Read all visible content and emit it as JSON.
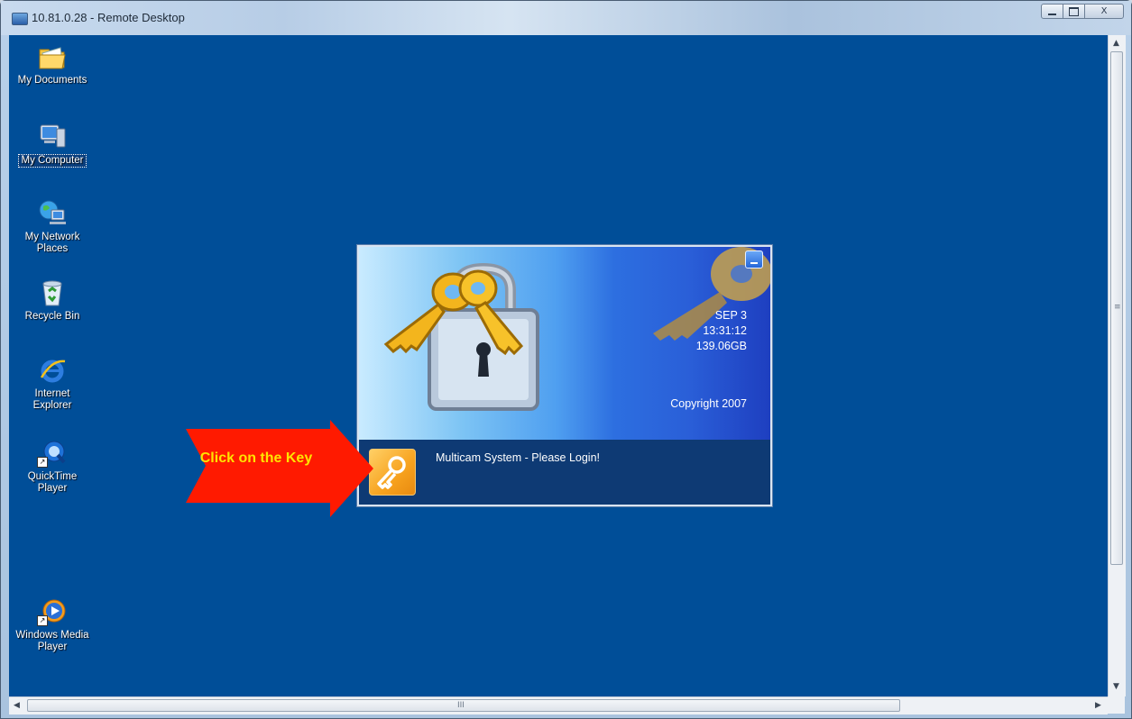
{
  "window": {
    "title": "10.81.0.28 - Remote Desktop",
    "controls": {
      "minimize": "minimize",
      "maximize": "maximize",
      "close": "X"
    }
  },
  "desktop": {
    "background_color": "#004e98",
    "icons": [
      {
        "label": "My Documents",
        "icon": "my-documents-icon",
        "focused": false
      },
      {
        "label": "My Computer",
        "icon": "my-computer-icon",
        "focused": true
      },
      {
        "label": "My Network Places",
        "icon": "network-places-icon",
        "focused": false
      },
      {
        "label": "Recycle Bin",
        "icon": "recycle-bin-icon",
        "focused": false
      },
      {
        "label": "Internet Explorer",
        "icon": "internet-explorer-icon",
        "focused": false
      },
      {
        "label": "QuickTime Player",
        "icon": "quicktime-icon",
        "focused": false
      },
      {
        "label": "Windows Media Player",
        "icon": "media-player-icon",
        "focused": false
      }
    ]
  },
  "login_panel": {
    "date": "SEP  3",
    "time": "13:31:12",
    "disk": "139.06GB",
    "copyright": "Copyright 2007",
    "message": "Multicam System - Please Login!",
    "key_icon": "key-icon"
  },
  "callout": {
    "text": "Click on the Key",
    "color": "#ff1a00",
    "text_color": "#ffe300"
  },
  "scrollbars": {
    "horizontal_grip": "III",
    "vertical_grip": "≡"
  }
}
